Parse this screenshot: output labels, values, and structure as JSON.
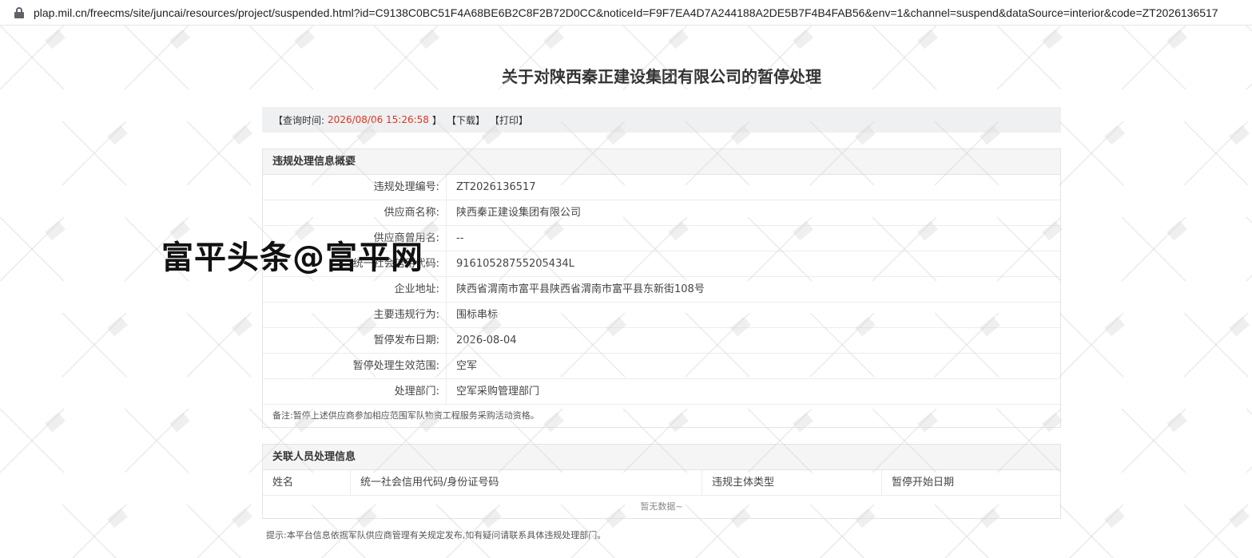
{
  "browser": {
    "url": "plap.mil.cn/freecms/site/juncai/resources/project/suspended.html?id=C9138C0BC51F4A68BE6B2C8F2B72D0CC&noticeId=F9F7EA4D7A244188A2DE5B7F4B4FAB56&env=1&channel=suspend&dataSource=interior&code=ZT2026136517"
  },
  "page": {
    "title": "关于对陕西秦正建设集团有限公司的暂停处理"
  },
  "toolbar": {
    "query_prefix": "【查询时间:",
    "query_time": "2026/08/06 15:26:58",
    "query_suffix": "】",
    "download_label": "【下载】",
    "print_label": "【打印】"
  },
  "violation": {
    "heading": "违规处理信息概要",
    "rows": [
      {
        "label": "违规处理编号:",
        "value": "ZT2026136517"
      },
      {
        "label": "供应商名称:",
        "value": "陕西秦正建设集团有限公司"
      },
      {
        "label": "供应商曾用名:",
        "value": "--"
      },
      {
        "label": "统一社会信用代码:",
        "value": "91610528755205434L"
      },
      {
        "label": "企业地址:",
        "value": "陕西省渭南市富平县陕西省渭南市富平县东新街108号"
      },
      {
        "label": "主要违规行为:",
        "value": "围标串标"
      },
      {
        "label": "暂停发布日期:",
        "value": "2026-08-04"
      },
      {
        "label": "暂停处理生效范围:",
        "value": "空军"
      },
      {
        "label": "处理部门:",
        "value": "空军采购管理部门"
      }
    ],
    "note": "备注:暂停上述供应商参加相应范围军队物资工程服务采购活动资格。"
  },
  "personnel": {
    "heading": "关联人员处理信息",
    "columns": [
      "姓名",
      "统一社会信用代码/身份证号码",
      "违规主体类型",
      "暂停开始日期"
    ],
    "empty_text": "暂无数据~"
  },
  "footer": {
    "tip": "提示:本平台信息依据军队供应商管理有关规定发布,如有疑问请联系具体违规处理部门。"
  },
  "overlay": {
    "brand": "富平头条@富平网"
  },
  "colors": {
    "accent_time": "#e0351f",
    "toolbar_bg": "#eef0f2",
    "header_bg": "#f5f5f5"
  }
}
